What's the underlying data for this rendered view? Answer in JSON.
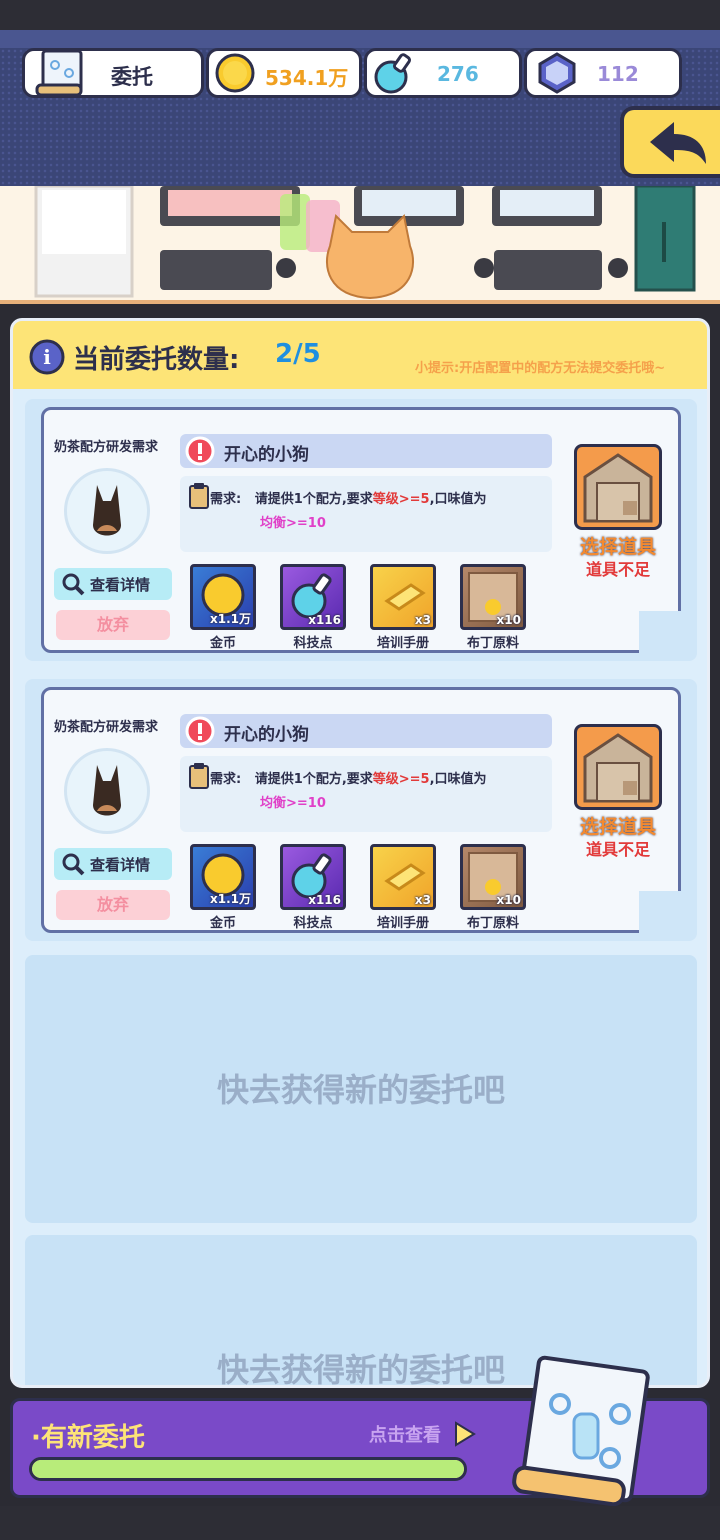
{
  "header": {
    "title": "委托",
    "gold": "534.1万",
    "tech_points": "276",
    "gems": "112"
  },
  "panel": {
    "title": "当前委托数量:",
    "count": "2/5",
    "tip": "小提示:开店配置中的配方无法提交委托哦~"
  },
  "commissions": [
    {
      "type": "奶茶配方研发需求",
      "name": "开心的小狗",
      "requirement_label": "需求:",
      "requirement_prefix": "请提供1个配方,要求",
      "requirement_red": "等级>=5",
      "requirement_suffix": ",口味值为",
      "requirement_line2": "均衡>=10",
      "detail_button": "查看详情",
      "giveup_button": "放弃",
      "select_label": "选择道具",
      "select_warning": "道具不足",
      "rewards": [
        {
          "name": "金币",
          "count": "x1.1万",
          "icon": "coin-icon"
        },
        {
          "name": "科技点",
          "count": "x116",
          "icon": "flask-icon"
        },
        {
          "name": "培训手册",
          "count": "x3",
          "icon": "book-icon"
        },
        {
          "name": "布丁原料",
          "count": "x10",
          "icon": "pudding-box-icon"
        }
      ]
    },
    {
      "type": "奶茶配方研发需求",
      "name": "开心的小狗",
      "requirement_label": "需求:",
      "requirement_prefix": "请提供1个配方,要求",
      "requirement_red": "等级>=5",
      "requirement_suffix": ",口味值为",
      "requirement_line2": "均衡>=10",
      "detail_button": "查看详情",
      "giveup_button": "放弃",
      "select_label": "选择道具",
      "select_warning": "道具不足",
      "rewards": [
        {
          "name": "金币",
          "count": "x1.1万",
          "icon": "coin-icon"
        },
        {
          "name": "科技点",
          "count": "x116",
          "icon": "flask-icon"
        },
        {
          "name": "培训手册",
          "count": "x3",
          "icon": "book-icon"
        },
        {
          "name": "布丁原料",
          "count": "x10",
          "icon": "pudding-box-icon"
        }
      ]
    }
  ],
  "empty_slots": [
    "快去获得新的委托吧",
    "快去获得新的委托吧"
  ],
  "bottom": {
    "new_label": "·有新委托",
    "view_label": "点击查看",
    "progress": 1.0
  },
  "colors": {
    "header_bg": "#3b4677",
    "accent_yellow": "#fde477",
    "purple_bar": "#7a4ac8",
    "warning_red": "#e23a3a"
  }
}
